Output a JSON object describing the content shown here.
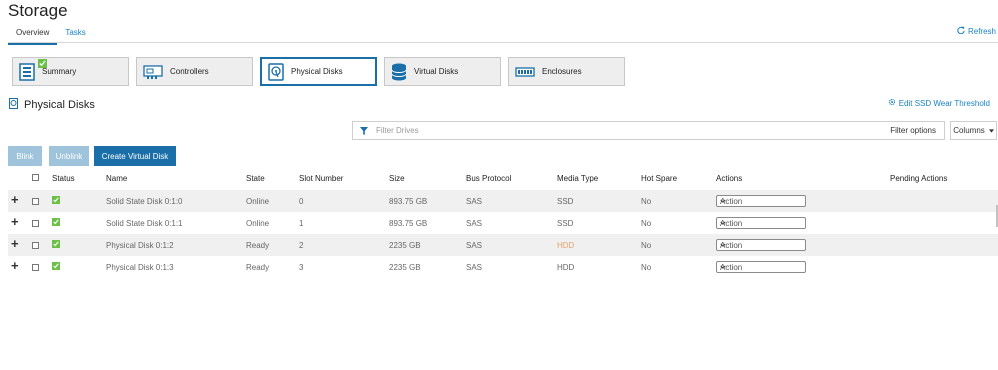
{
  "page": {
    "title": "Storage"
  },
  "tabs": [
    {
      "label": "Overview"
    },
    {
      "label": "Tasks"
    }
  ],
  "refresh_label": "Refresh",
  "tiles": [
    {
      "label": "Summary",
      "icon": "summary-icon"
    },
    {
      "label": "Controllers",
      "icon": "controller-card-icon"
    },
    {
      "label": "Physical Disks",
      "icon": "physical-disk-icon",
      "selected": true
    },
    {
      "label": "Virtual Disks",
      "icon": "database-icon"
    },
    {
      "label": "Enclosures",
      "icon": "enclosure-icon"
    }
  ],
  "section": {
    "title": "Physical Disks",
    "edit_link": "Edit SSD Wear Threshold"
  },
  "filter": {
    "placeholder": "Filter Drives",
    "options_label": "Filter options",
    "columns_label": "Columns"
  },
  "buttons": {
    "blink": "Blink",
    "unblink": "Unblink",
    "create_vd": "Create Virtual Disk"
  },
  "table": {
    "headers": {
      "status": "Status",
      "name": "Name",
      "state": "State",
      "slot": "Slot Number",
      "size": "Size",
      "bus": "Bus Protocol",
      "media": "Media Type",
      "hot_spare": "Hot Spare",
      "actions": "Actions",
      "pending": "Pending Actions"
    },
    "rows": [
      {
        "name": "Solid State Disk 0:1:0",
        "state": "Online",
        "slot": "0",
        "size": "893.75 GB",
        "bus": "SAS",
        "media": "SSD",
        "hot_spare": "No",
        "action": "Action"
      },
      {
        "name": "Solid State Disk 0:1:1",
        "state": "Online",
        "slot": "1",
        "size": "893.75 GB",
        "bus": "SAS",
        "media": "SSD",
        "hot_spare": "No",
        "action": "Action"
      },
      {
        "name": "Physical Disk 0:1:2",
        "state": "Ready",
        "slot": "2",
        "size": "2235 GB",
        "bus": "SAS",
        "media": "HDD",
        "hot_spare": "No",
        "action": "Action"
      },
      {
        "name": "Physical Disk 0:1:3",
        "state": "Ready",
        "slot": "3",
        "size": "2235 GB",
        "bus": "SAS",
        "media": "HDD",
        "hot_spare": "No",
        "action": "Action"
      }
    ]
  },
  "colors": {
    "accent": "#1a6fa8",
    "link": "#1a82c4",
    "ok": "#6cbf47",
    "disabled": "#9ec3db"
  }
}
